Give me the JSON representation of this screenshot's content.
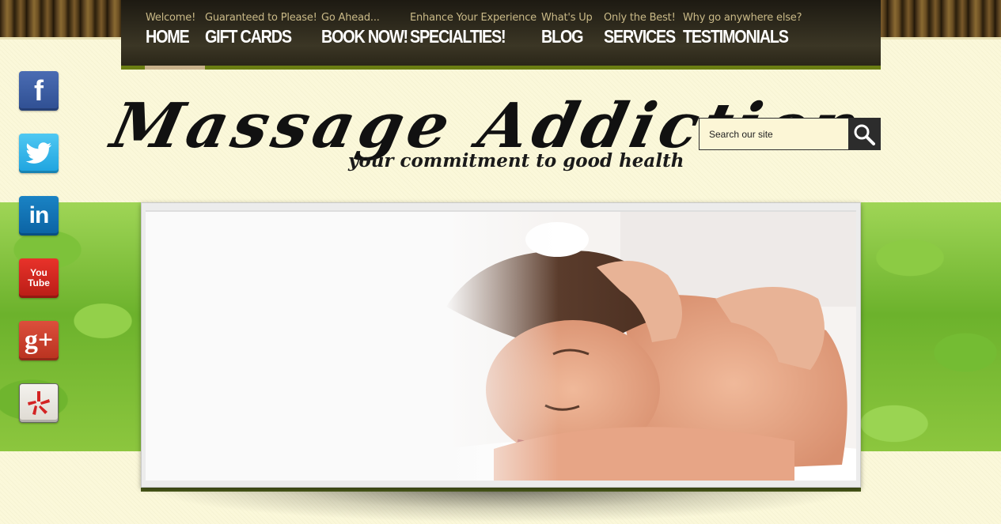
{
  "nav": {
    "items": [
      {
        "sub": "Welcome!",
        "main": "HOME"
      },
      {
        "sub": "Guaranteed to Please!",
        "main": "GIFT CARDS"
      },
      {
        "sub": "Go Ahead...",
        "main": "BOOK NOW!"
      },
      {
        "sub": "Enhance Your Experience",
        "main": "SPECIALTIES!"
      },
      {
        "sub": "What's Up",
        "main": "BLOG"
      },
      {
        "sub": "Only the Best!",
        "main": "SERVICES"
      },
      {
        "sub": "Why go anywhere else?",
        "main": "TESTIMONIALS"
      }
    ],
    "active_index": 0
  },
  "social": [
    {
      "name": "facebook",
      "icon": "facebook-icon"
    },
    {
      "name": "twitter",
      "icon": "twitter-icon"
    },
    {
      "name": "linkedin",
      "icon": "linkedin-icon"
    },
    {
      "name": "youtube",
      "icon": "youtube-icon"
    },
    {
      "name": "google-plus",
      "icon": "google-plus-icon"
    },
    {
      "name": "yelp",
      "icon": "yelp-icon"
    }
  ],
  "social_labels": {
    "facebook": "f",
    "linkedin": "in",
    "youtube_top": "You",
    "youtube_bottom": "Tube",
    "google_plus": "g+"
  },
  "logo": {
    "script": "Massage Addiction",
    "tagline": "your commitment to good health"
  },
  "search": {
    "placeholder": "Search our site"
  },
  "colors": {
    "nav_bg": "#2f2b1e",
    "nav_accent": "#6a7d12",
    "page_bg": "#fbf8da",
    "leaf_green": "#7dc23a"
  }
}
